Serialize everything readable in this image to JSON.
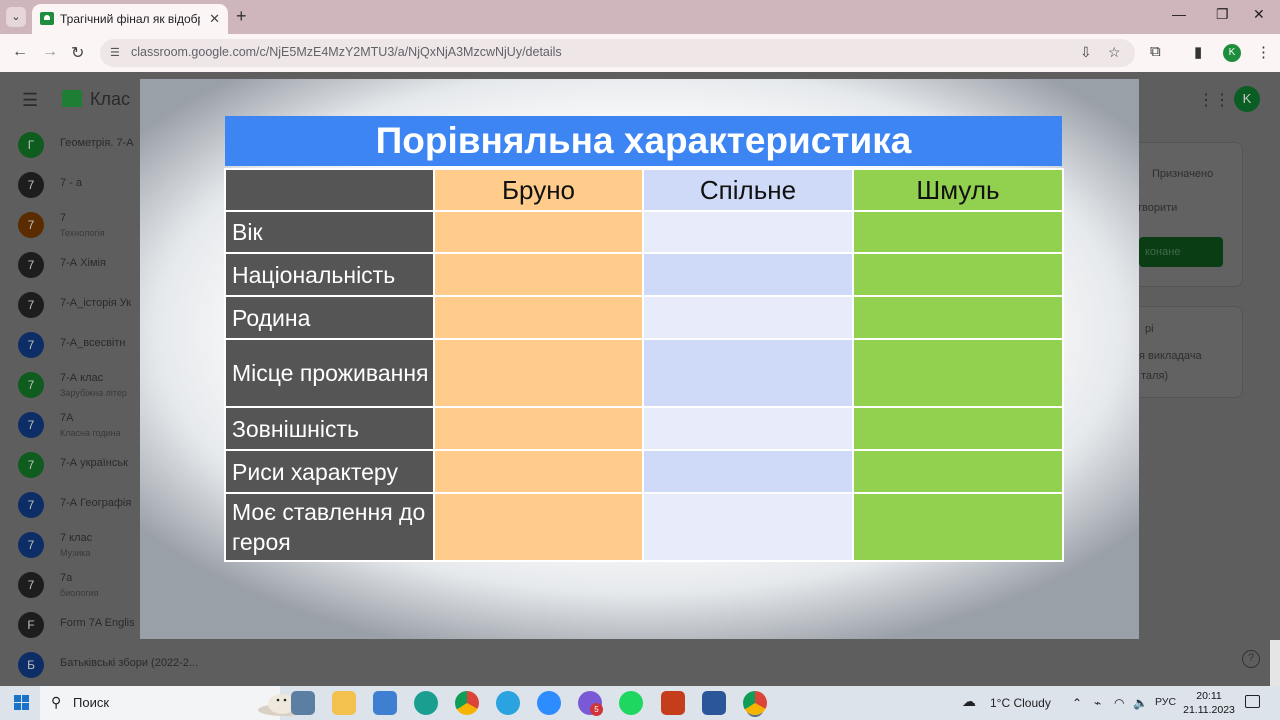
{
  "browser": {
    "tab_title": "Трагічний фінал як відображе",
    "tab_close": "✕",
    "new_tab": "+",
    "url": "classroom.google.com/c/NjE5MzE4MzY2MTU3/a/NjQxNjA3MzcwNjUy/details",
    "profile_letter": "K"
  },
  "classroom": {
    "title": "Клас",
    "avatar_letter": "K",
    "courses": [
      {
        "letter": "Г",
        "name": "Геометрія. 7-А",
        "sub": "",
        "color": "#0e5c1e"
      },
      {
        "letter": "7",
        "name": "7 - а",
        "sub": "",
        "color": "#1d1d1d"
      },
      {
        "letter": "7",
        "name": "7",
        "sub": "Технологія",
        "color": "#5a2c00"
      },
      {
        "letter": "7",
        "name": "7-А Хімія",
        "sub": "",
        "color": "#1d1d1d"
      },
      {
        "letter": "7",
        "name": "7-А_історія Ук",
        "sub": "",
        "color": "#1d1d1d"
      },
      {
        "letter": "7",
        "name": "7-А_всесвітн",
        "sub": "",
        "color": "#0c2d66"
      },
      {
        "letter": "7",
        "name": "7-А клас",
        "sub": "Зарубіжна літер",
        "color": "#0e5c1e"
      },
      {
        "letter": "7",
        "name": "7А",
        "sub": "Класна година",
        "color": "#0c2d66"
      },
      {
        "letter": "7",
        "name": "7-А українськ",
        "sub": "",
        "color": "#0e5c1e"
      },
      {
        "letter": "7",
        "name": "7-А Географія",
        "sub": "",
        "color": "#0c2d66"
      },
      {
        "letter": "7",
        "name": "7 клас",
        "sub": "Музика",
        "color": "#0c2d66"
      },
      {
        "letter": "7",
        "name": "7а",
        "sub": "биология",
        "color": "#1d1d1d"
      },
      {
        "letter": "F",
        "name": "Form 7A Englis",
        "sub": "",
        "color": "#1d1d1d"
      },
      {
        "letter": "Б",
        "name": "Батьківські збори (2022-2...",
        "sub": "",
        "color": "#0c2d66"
      }
    ],
    "right_panel": {
      "assigned": "Призначено",
      "create": "творити",
      "done": "конане",
      "comments": "рі",
      "teacher": "я викладача",
      "teacher2": "таля)"
    }
  },
  "slide": {
    "title": "Порівняльна характеристика",
    "columns": [
      "Бруно",
      "Спільне",
      "Шмуль"
    ],
    "rows": [
      "Вік",
      "Національність",
      "Родина",
      "Місце проживання",
      "Зовнішність",
      "Риси характеру",
      "Моє ставлення до героя"
    ]
  },
  "taskbar": {
    "search_label": "Поиск",
    "weather": "1°C  Cloudy",
    "language": "РУС",
    "time": "20:11",
    "date": "21.11.2023",
    "viber_badge": "5"
  }
}
